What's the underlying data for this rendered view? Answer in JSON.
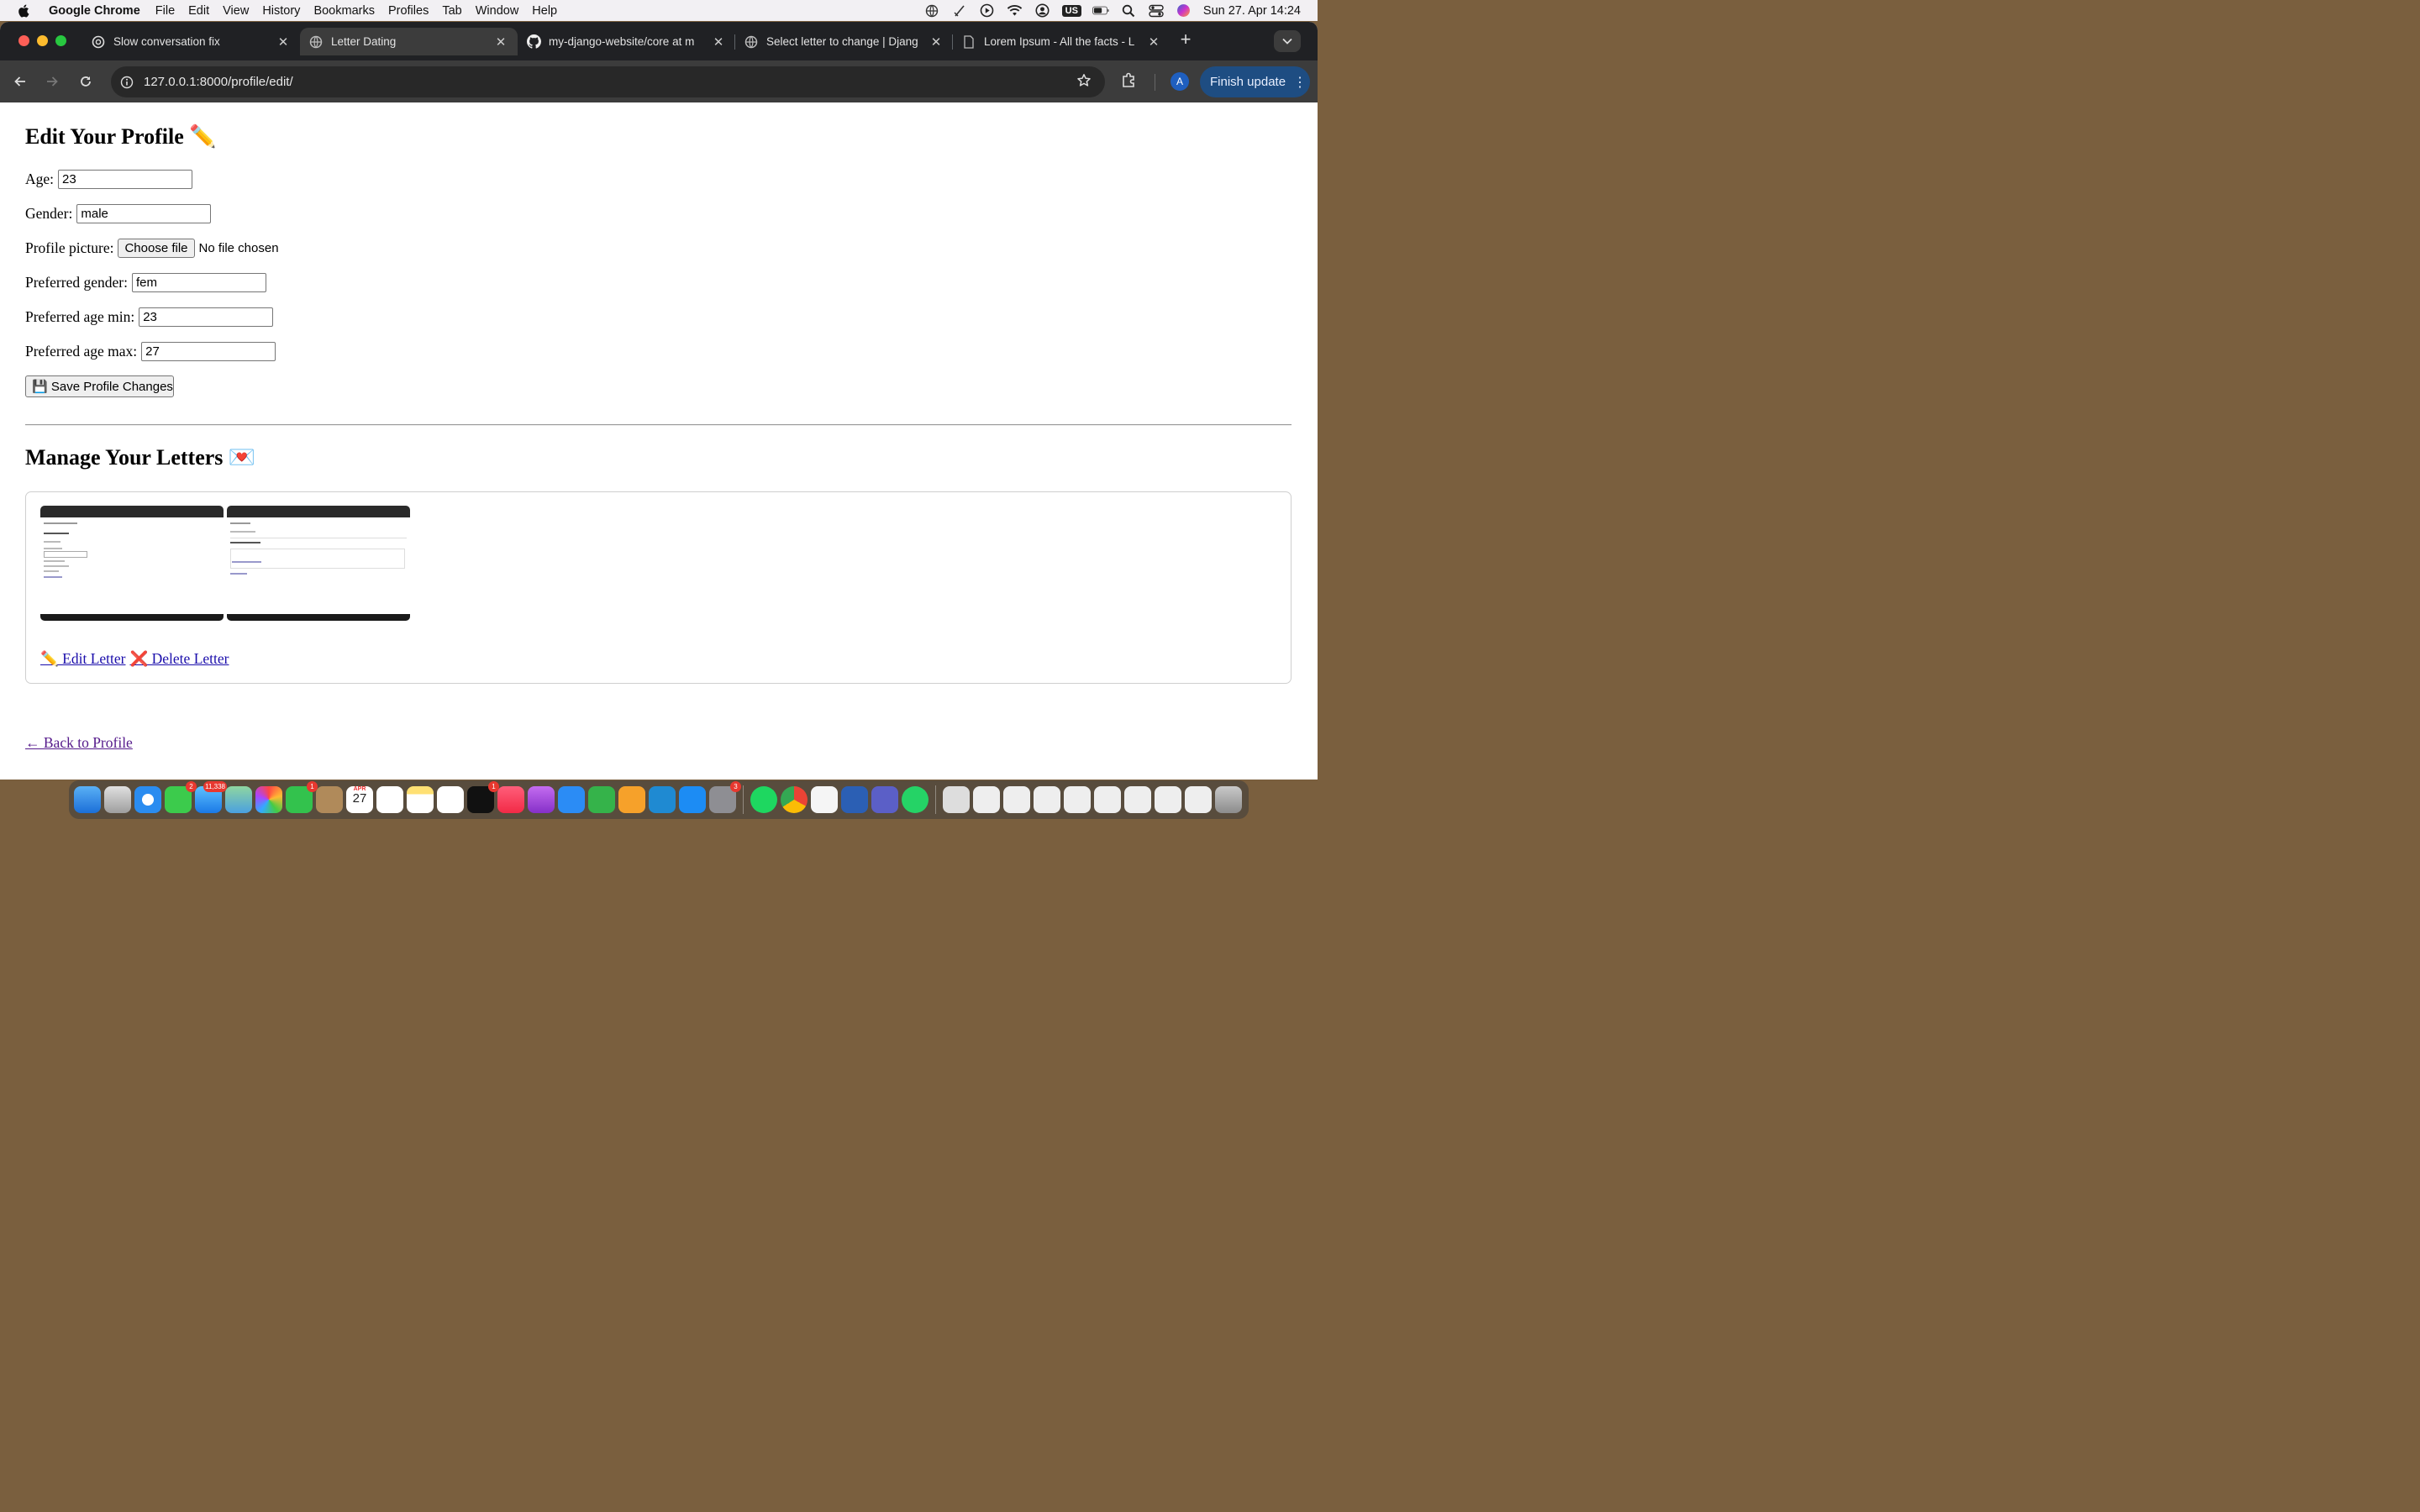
{
  "menubar": {
    "app_name": "Google Chrome",
    "menus": [
      "File",
      "Edit",
      "View",
      "History",
      "Bookmarks",
      "Profiles",
      "Tab",
      "Window",
      "Help"
    ],
    "input_source": "US",
    "clock": "Sun 27. Apr  14:24"
  },
  "browser": {
    "tabs": [
      {
        "title": "Slow conversation fix",
        "icon": "chatgpt-icon"
      },
      {
        "title": "Letter Dating",
        "icon": "globe-icon"
      },
      {
        "title": "my-django-website/core at m",
        "icon": "github-icon"
      },
      {
        "title": "Select letter to change | Djang",
        "icon": "globe-icon"
      },
      {
        "title": "Lorem Ipsum - All the facts - L",
        "icon": "document-icon"
      }
    ],
    "active_tab": 1,
    "url": "127.0.0.1:8000/profile/edit/",
    "profile_initial": "A",
    "finish_update_label": "Finish update"
  },
  "page": {
    "title": "Edit Your Profile ✏️",
    "fields": {
      "age": {
        "label": "Age:",
        "value": "23"
      },
      "gender": {
        "label": "Gender:",
        "value": "male"
      },
      "picture": {
        "label": "Profile picture:",
        "button": "Choose file",
        "status": "No file chosen"
      },
      "pref_gender": {
        "label": "Preferred gender:",
        "value": "fem"
      },
      "pref_age_min": {
        "label": "Preferred age min:",
        "value": "23"
      },
      "pref_age_max": {
        "label": "Preferred age max:",
        "value": "27"
      }
    },
    "save_button": "💾 Save Profile Changes",
    "letters_title": "Manage Your Letters 💌",
    "edit_letter": "✏️ Edit Letter",
    "delete_letter": "❌ Delete Letter",
    "back_link": "← Back to Profile"
  },
  "dock": {
    "badges": {
      "messages": "2",
      "mail": "11,338",
      "facetime": "1",
      "tv": "1",
      "settings": "3"
    },
    "calendar_month": "APR",
    "calendar_day": "27"
  },
  "colors": {
    "tabstrip": "#202124",
    "toolbar": "#3c3c3c",
    "finish_update": "#1e4d82",
    "link": "#1a0dab",
    "visited_link": "#551a8b"
  }
}
